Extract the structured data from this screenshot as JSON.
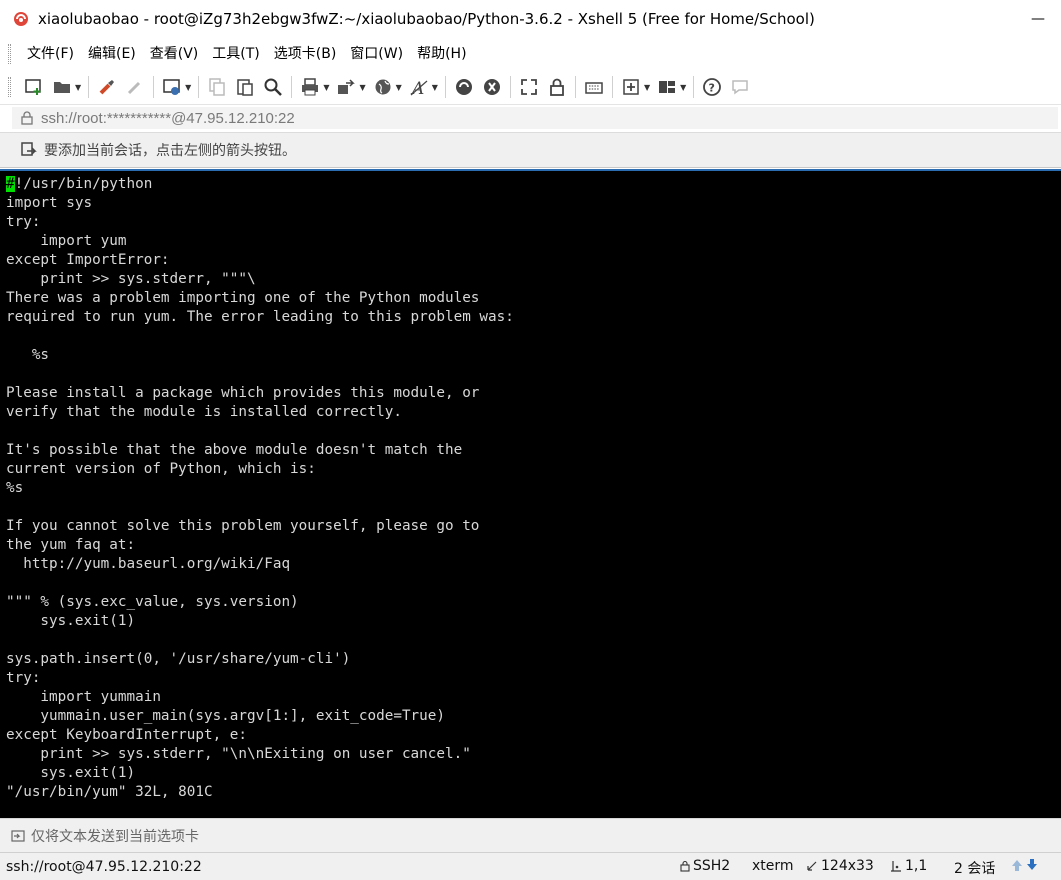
{
  "window": {
    "title": "xiaolubaobao - root@iZg73h2ebgw3fwZ:~/xiaolubaobao/Python-3.6.2 - Xshell 5 (Free for Home/School)",
    "logo_icon": "xshell-logo-icon",
    "minimize_glyph": "—"
  },
  "menu": {
    "items": [
      {
        "label": "文件(F)"
      },
      {
        "label": "编辑(E)"
      },
      {
        "label": "查看(V)"
      },
      {
        "label": "工具(T)"
      },
      {
        "label": "选项卡(B)"
      },
      {
        "label": "窗口(W)"
      },
      {
        "label": "帮助(H)"
      }
    ]
  },
  "toolbar": {
    "buttons": [
      "new-session-icon",
      "open-folder-icon",
      "reconnect-icon",
      "disconnect-icon",
      "properties-icon",
      "copy-icon",
      "paste-icon",
      "find-icon",
      "print-icon",
      "transfer-icon",
      "globe-icon",
      "font-icon",
      "xftp-icon",
      "xmanager-icon",
      "fullscreen-icon",
      "lock-icon",
      "keyboard-icon",
      "new-tab-icon",
      "layout-icon",
      "help-icon",
      "chat-icon"
    ]
  },
  "address": {
    "value": "ssh://root:***********@47.95.12.210:22",
    "lock_icon": "lock-icon"
  },
  "session_hint": {
    "text": "要添加当前会话，点击左侧的箭头按钮。"
  },
  "terminal": {
    "cursor_char": "#",
    "first_line_rest": "!/usr/bin/python",
    "body": "import sys\ntry:\n    import yum\nexcept ImportError:\n    print >> sys.stderr, \"\"\"\\\nThere was a problem importing one of the Python modules\nrequired to run yum. The error leading to this problem was:\n\n   %s\n\nPlease install a package which provides this module, or\nverify that the module is installed correctly.\n\nIt's possible that the above module doesn't match the\ncurrent version of Python, which is:\n%s\n\nIf you cannot solve this problem yourself, please go to\nthe yum faq at:\n  http://yum.baseurl.org/wiki/Faq\n\n\"\"\" % (sys.exc_value, sys.version)\n    sys.exit(1)\n\nsys.path.insert(0, '/usr/share/yum-cli')\ntry:\n    import yummain\n    yummain.user_main(sys.argv[1:], exit_code=True)\nexcept KeyboardInterrupt, e:\n    print >> sys.stderr, \"\\n\\nExiting on user cancel.\"\n    sys.exit(1)\n\"/usr/bin/yum\" 32L, 801C"
  },
  "send_bar": {
    "text": "仅将文本发送到当前选项卡"
  },
  "status": {
    "connection": "ssh://root@47.95.12.210:22",
    "protocol": "SSH2",
    "terminal_type": "xterm",
    "size": "124x33",
    "cursor_pos": "1,1",
    "sessions": "2 会话"
  }
}
